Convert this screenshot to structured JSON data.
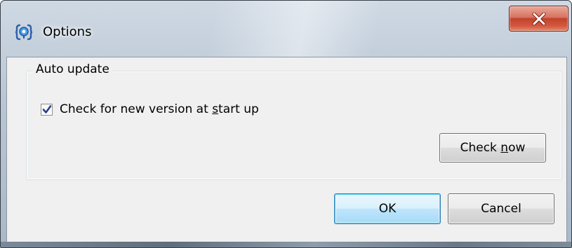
{
  "window": {
    "title": "Options",
    "icon": "app-options-icon",
    "close_icon": "close-icon",
    "accent_close": "#c2432c"
  },
  "auto_update": {
    "group_label": "Auto update",
    "checkbox": {
      "label_before": "Check for new version at ",
      "label_mnemonic": "s",
      "label_after": "tart up",
      "checked": true
    },
    "check_now_button": {
      "label_before": "Check ",
      "label_mnemonic": "n",
      "label_after": "ow"
    }
  },
  "footer": {
    "ok_label": "OK",
    "cancel_label": "Cancel"
  }
}
